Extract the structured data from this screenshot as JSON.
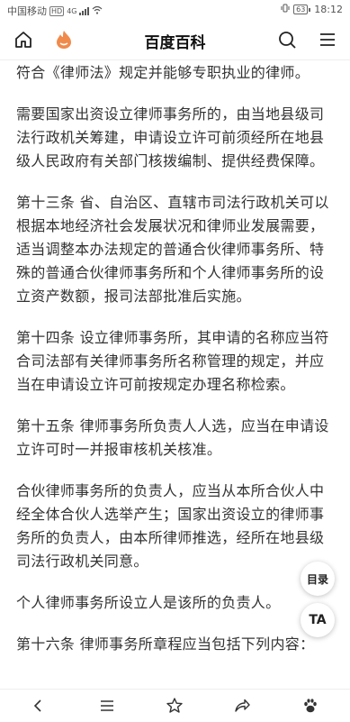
{
  "status_bar": {
    "carrier": "中国移动",
    "hd": "HD",
    "network": "4G",
    "battery": "63",
    "time": "18:12"
  },
  "nav": {
    "title": "百度百科",
    "icons": [
      "home-icon",
      "baike-logo-icon",
      "search-icon",
      "menu-icon"
    ]
  },
  "paragraphs": [
    "符合《律师法》规定并能够专职执业的律师。",
    "需要国家出资设立律师事务所的，由当地县级司法行政机关筹建，申请设立许可前须经所在地县级人民政府有关部门核拨编制、提供经费保障。",
    "第十三条 省、自治区、直辖市司法行政机关可以根据本地经济社会发展状况和律师业发展需要，适当调整本办法规定的普通合伙律师事务所、特殊的普通合伙律师事务所和个人律师事务所的设立资产数额，报司法部批准后实施。",
    "第十四条 设立律师事务所，其申请的名称应当符合司法部有关律师事务所名称管理的规定，并应当在申请设立许可前按规定办理名称检索。",
    "第十五条 律师事务所负责人人选，应当在申请设立许可时一并报审核机关核准。",
    "合伙律师事务所的负责人，应当从本所合伙人中经全体合伙人选举产生；国家出资设立的律师事务所的负责人，由本所律师推选，经所在地县级司法行政机关同意。",
    "个人律师事务所设立人是该所的负责人。",
    "第十六条 律师事务所章程应当包括下列内容："
  ],
  "fabs": {
    "toc": "目录",
    "text_size": "TA"
  },
  "bottom_bar": {
    "icons": [
      "back-icon",
      "list-icon",
      "star-icon",
      "share-icon",
      "baidu-paw-icon"
    ]
  }
}
